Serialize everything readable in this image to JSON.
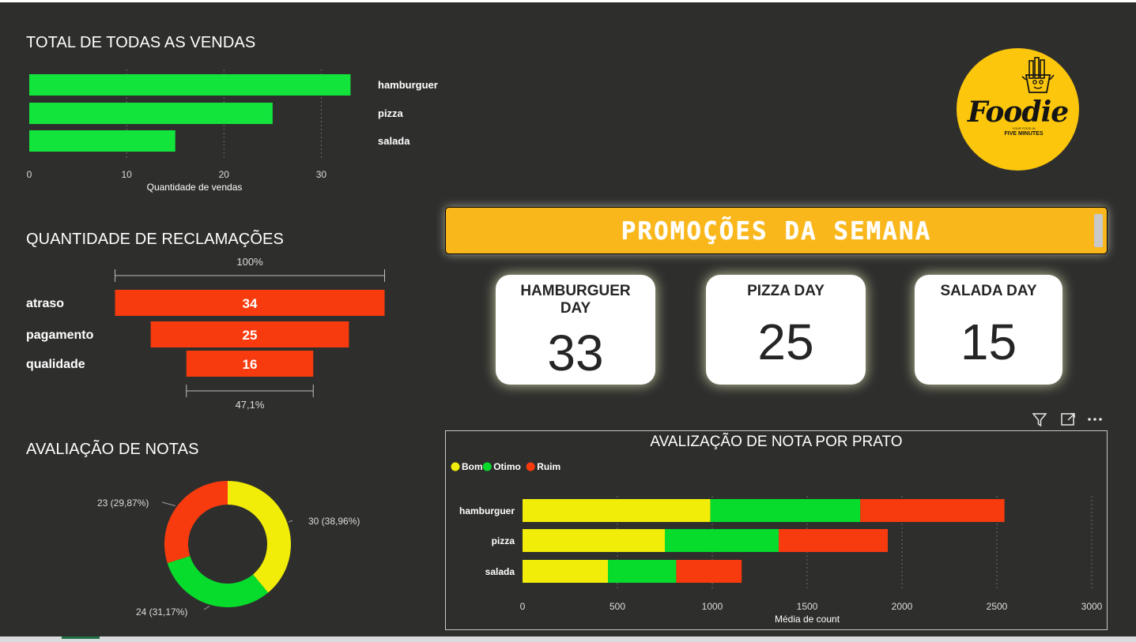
{
  "sales": {
    "title": "TOTAL DE TODAS AS VENDAS",
    "chart_data": {
      "type": "bar",
      "orientation": "horizontal",
      "categories": [
        "hamburguer",
        "pizza",
        "salada"
      ],
      "values": [
        33,
        25,
        15
      ],
      "xlabel": "Quantidade de vendas",
      "xlim": [
        0,
        35
      ],
      "xticks": [
        0,
        10,
        20,
        30
      ],
      "grid": true,
      "color": "#13e43c"
    }
  },
  "complaints": {
    "title": "QUANTIDADE DE RECLAMAÇÕES",
    "chart_data": {
      "type": "funnel",
      "categories": [
        "atraso",
        "pagamento",
        "qualidade"
      ],
      "values": [
        34,
        25,
        16
      ],
      "top_label": "100%",
      "bottom_label": "47,1%",
      "color": "#f83b0e"
    }
  },
  "ratings": {
    "title": "AVALIAÇÃO DE NOTAS",
    "chart_data": {
      "type": "donut",
      "slices": [
        {
          "value": 30,
          "label": "30 (38,96%)",
          "color": "#f1ec08"
        },
        {
          "value": 24,
          "label": "24 (31,17%)",
          "color": "#07dc2c"
        },
        {
          "value": 23,
          "label": "23 (29,87%)",
          "color": "#f83b0e"
        }
      ]
    }
  },
  "logo": {
    "name": "Foodie",
    "tagline_small": "YOUR FOOD IN",
    "tagline": "FIVE MINUTES",
    "bg_color": "#fcc60c"
  },
  "banner": {
    "text": "PROMOÇÕES DA SEMANA",
    "color": "#f9b71b"
  },
  "cards": [
    {
      "label": "HAMBURGUER DAY",
      "value": "33"
    },
    {
      "label": "PIZZA DAY",
      "value": "25"
    },
    {
      "label": "SALADA DAY",
      "value": "15"
    }
  ],
  "dish_ratings": {
    "chart_data": {
      "type": "bar",
      "orientation": "horizontal",
      "stacked": true,
      "title": "AVALIZAÇÃO DE NOTA POR PRATO",
      "categories": [
        "hamburguer",
        "pizza",
        "salada"
      ],
      "series": [
        {
          "name": "Bom",
          "values": [
            990,
            750,
            450
          ],
          "color": "#f1ec08"
        },
        {
          "name": "Otimo",
          "values": [
            790,
            600,
            360
          ],
          "color": "#07dc2c"
        },
        {
          "name": "Ruim",
          "values": [
            760,
            575,
            345
          ],
          "color": "#f83b0e"
        }
      ],
      "xlabel": "Média de count",
      "xlim": [
        0,
        3000
      ],
      "xticks": [
        0,
        500,
        1000,
        1500,
        2000,
        2500,
        3000
      ],
      "grid": true,
      "legend": "top-left"
    }
  },
  "visual_header": {
    "filter_icon": "filter-icon",
    "focus_icon": "focus-mode-icon",
    "more_icon": "more-options-icon"
  }
}
